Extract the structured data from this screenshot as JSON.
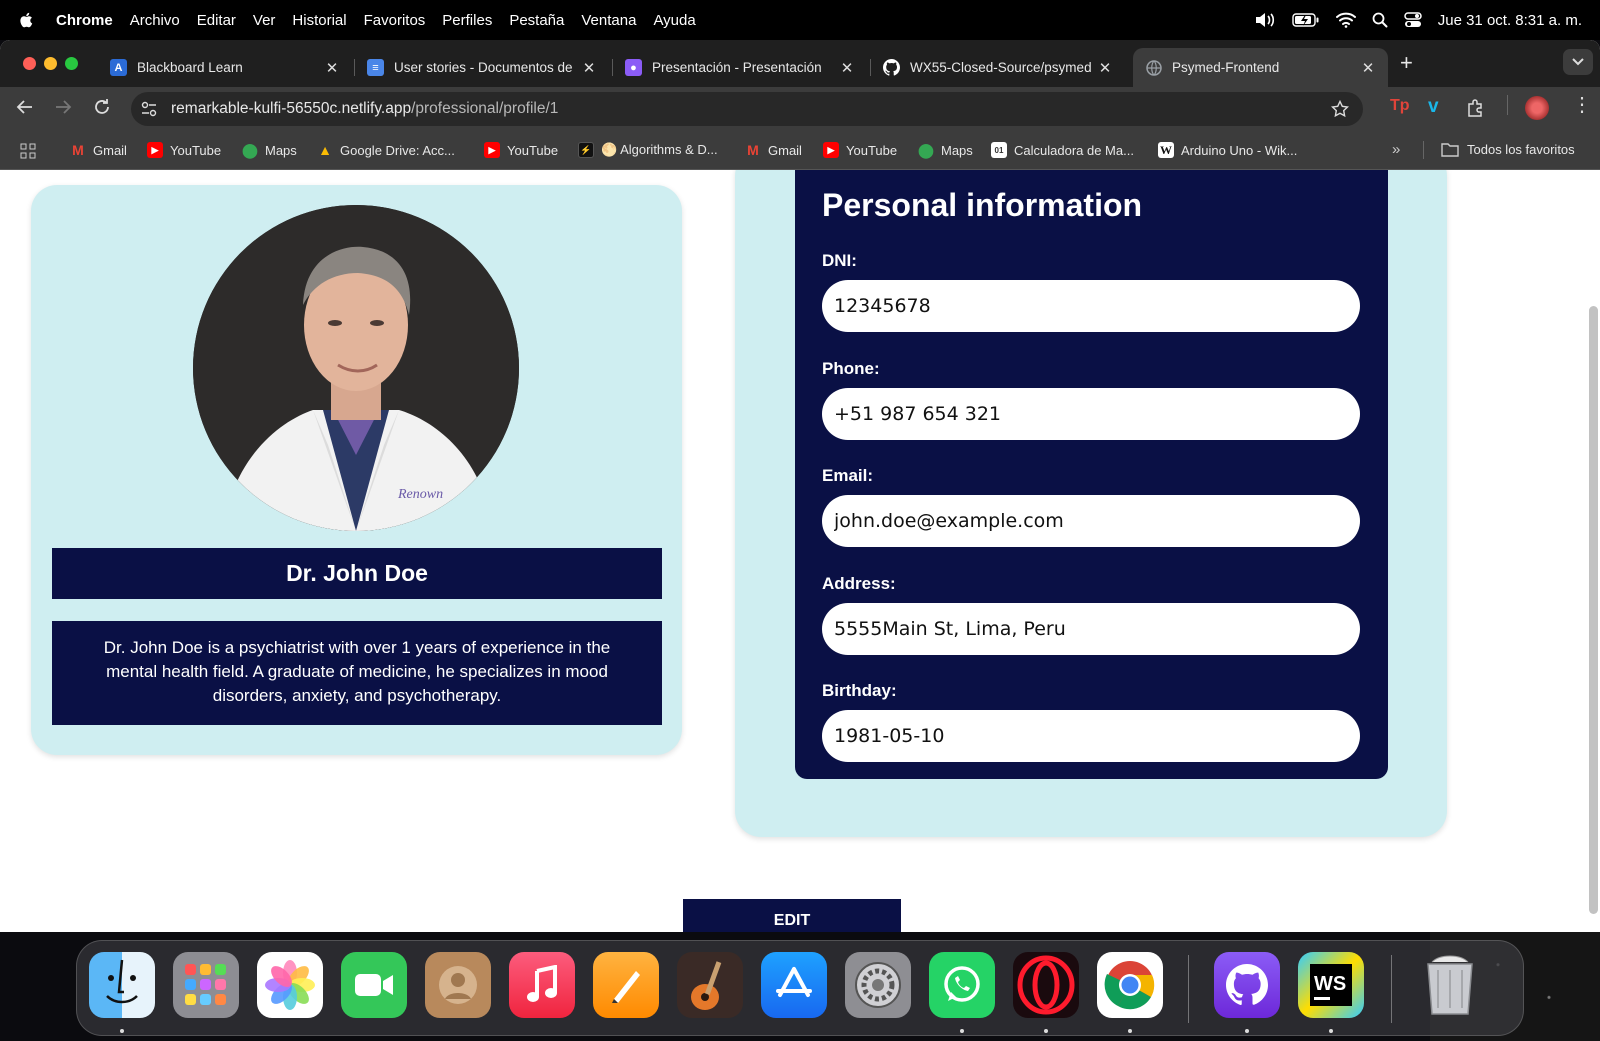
{
  "menubar": {
    "app_name": "Chrome",
    "menus": [
      "Archivo",
      "Editar",
      "Ver",
      "Historial",
      "Favoritos",
      "Perfiles",
      "Pestaña",
      "Ventana",
      "Ayuda"
    ],
    "datetime": "Jue 31 oct.  8:31 a. m."
  },
  "tabs": [
    {
      "title": "Blackboard Learn",
      "icon": "blackboard-icon",
      "color": "#2b6bd6"
    },
    {
      "title": "User stories - Documentos de",
      "icon": "google-docs-icon",
      "color": "#4a86e8"
    },
    {
      "title": "Presentación - Presentación",
      "icon": "presentation-icon",
      "color": "#8b5cf6"
    },
    {
      "title": "WX55-Closed-Source/psymed",
      "icon": "github-icon",
      "color": "#ffffff"
    },
    {
      "title": "Psymed-Frontend",
      "icon": "globe-icon",
      "color": "#9aa0a6",
      "active": true
    }
  ],
  "omnibox": {
    "host": "remarkable-kulfi-56550c.netlify.app",
    "path": "/professional/profile/1"
  },
  "bookmarks": [
    {
      "label": "Gmail",
      "icon": "gmail-icon"
    },
    {
      "label": "YouTube",
      "icon": "youtube-icon"
    },
    {
      "label": "Maps",
      "icon": "maps-icon"
    },
    {
      "label": "Google Drive: Acc...",
      "icon": "drive-icon"
    },
    {
      "label": "YouTube",
      "icon": "youtube-icon"
    },
    {
      "label": "🌕 Algorithms & D...",
      "icon": "bolt-icon"
    },
    {
      "label": "Gmail",
      "icon": "gmail-icon"
    },
    {
      "label": "YouTube",
      "icon": "youtube-icon"
    },
    {
      "label": "Maps",
      "icon": "maps-icon"
    },
    {
      "label": "Calculadora de Ma...",
      "icon": "calculator-icon"
    },
    {
      "label": "Arduino Uno - Wik...",
      "icon": "wikipedia-icon"
    }
  ],
  "bookmarks_folder": "Todos los favoritos",
  "profile": {
    "name": "Dr. John Doe",
    "bio": "Dr. John Doe is a psychiatrist with over 1 years of experience in the mental health field. A graduate of medicine, he specializes in mood disorders, anxiety, and psychotherapy."
  },
  "personal_info": {
    "title": "Personal information",
    "dni_label": "DNI:",
    "dni": "12345678",
    "phone_label": "Phone:",
    "phone": "+51 987 654 321",
    "email_label": "Email:",
    "email": "john.doe@example.com",
    "address_label": "Address:",
    "address": "5555Main St, Lima, Peru",
    "birthday_label": "Birthday:",
    "birthday": "1981-05-10"
  },
  "edit_label": "EDIT",
  "dock": [
    "finder",
    "launchpad",
    "photos",
    "facetime",
    "contacts",
    "music",
    "pages",
    "garageband",
    "app-store",
    "system-settings",
    "whatsapp",
    "opera",
    "chrome",
    "github-desktop",
    "webstorm",
    "trash"
  ]
}
